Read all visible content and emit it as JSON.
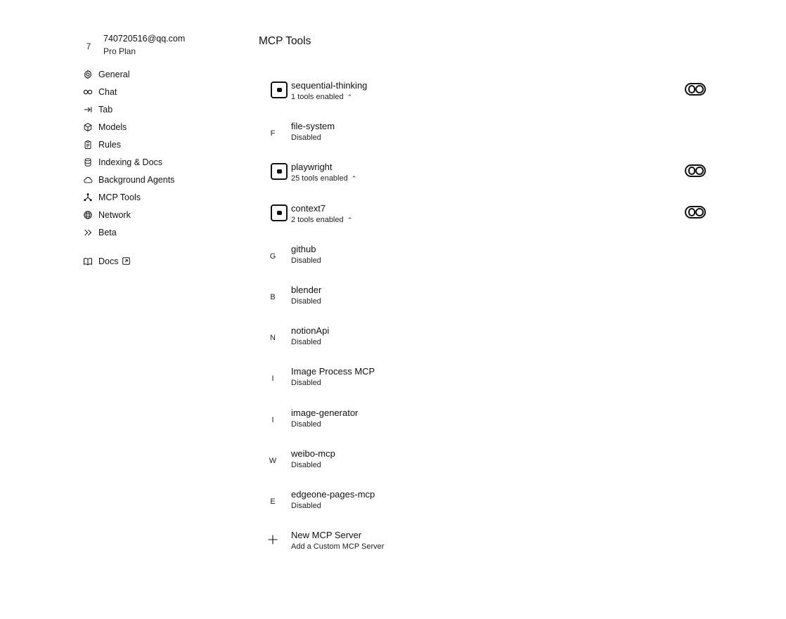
{
  "account": {
    "avatar_letter": "7",
    "email": "740720516@qq.com",
    "plan": "Pro Plan"
  },
  "sidebar": {
    "items": [
      {
        "label": "General",
        "icon": "gear-icon"
      },
      {
        "label": "Chat",
        "icon": "infinity-icon"
      },
      {
        "label": "Tab",
        "icon": "arrow-right-bar-icon"
      },
      {
        "label": "Models",
        "icon": "cube-icon"
      },
      {
        "label": "Rules",
        "icon": "clipboard-icon"
      },
      {
        "label": "Indexing & Docs",
        "icon": "database-icon"
      },
      {
        "label": "Background Agents",
        "icon": "cloud-icon"
      },
      {
        "label": "MCP Tools",
        "icon": "network-nodes-icon"
      },
      {
        "label": "Network",
        "icon": "globe-icon"
      },
      {
        "label": "Beta",
        "icon": "double-chevron-icon"
      }
    ],
    "docs": {
      "label": "Docs",
      "icon": "book-icon",
      "ext_icon": "external-link-icon"
    }
  },
  "main": {
    "title": "MCP Tools",
    "servers": [
      {
        "name": "sequential-thinking",
        "status": "1 tools enabled",
        "enabled": true,
        "avatar": ""
      },
      {
        "name": "file-system",
        "status": "Disabled",
        "enabled": false,
        "avatar": "F"
      },
      {
        "name": "playwright",
        "status": "25 tools enabled",
        "enabled": true,
        "avatar": ""
      },
      {
        "name": "context7",
        "status": "2 tools enabled",
        "enabled": true,
        "avatar": ""
      },
      {
        "name": "github",
        "status": "Disabled",
        "enabled": false,
        "avatar": "G"
      },
      {
        "name": "blender",
        "status": "Disabled",
        "enabled": false,
        "avatar": "B"
      },
      {
        "name": "notionApi",
        "status": "Disabled",
        "enabled": false,
        "avatar": "N"
      },
      {
        "name": "Image Process MCP",
        "status": "Disabled",
        "enabled": false,
        "avatar": "I"
      },
      {
        "name": "image-generator",
        "status": "Disabled",
        "enabled": false,
        "avatar": "I"
      },
      {
        "name": "weibo-mcp",
        "status": "Disabled",
        "enabled": false,
        "avatar": "W"
      },
      {
        "name": "edgeone-pages-mcp",
        "status": "Disabled",
        "enabled": false,
        "avatar": "E"
      }
    ],
    "add_server": {
      "name": "New MCP Server",
      "subtitle": "Add a Custom MCP Server"
    }
  }
}
